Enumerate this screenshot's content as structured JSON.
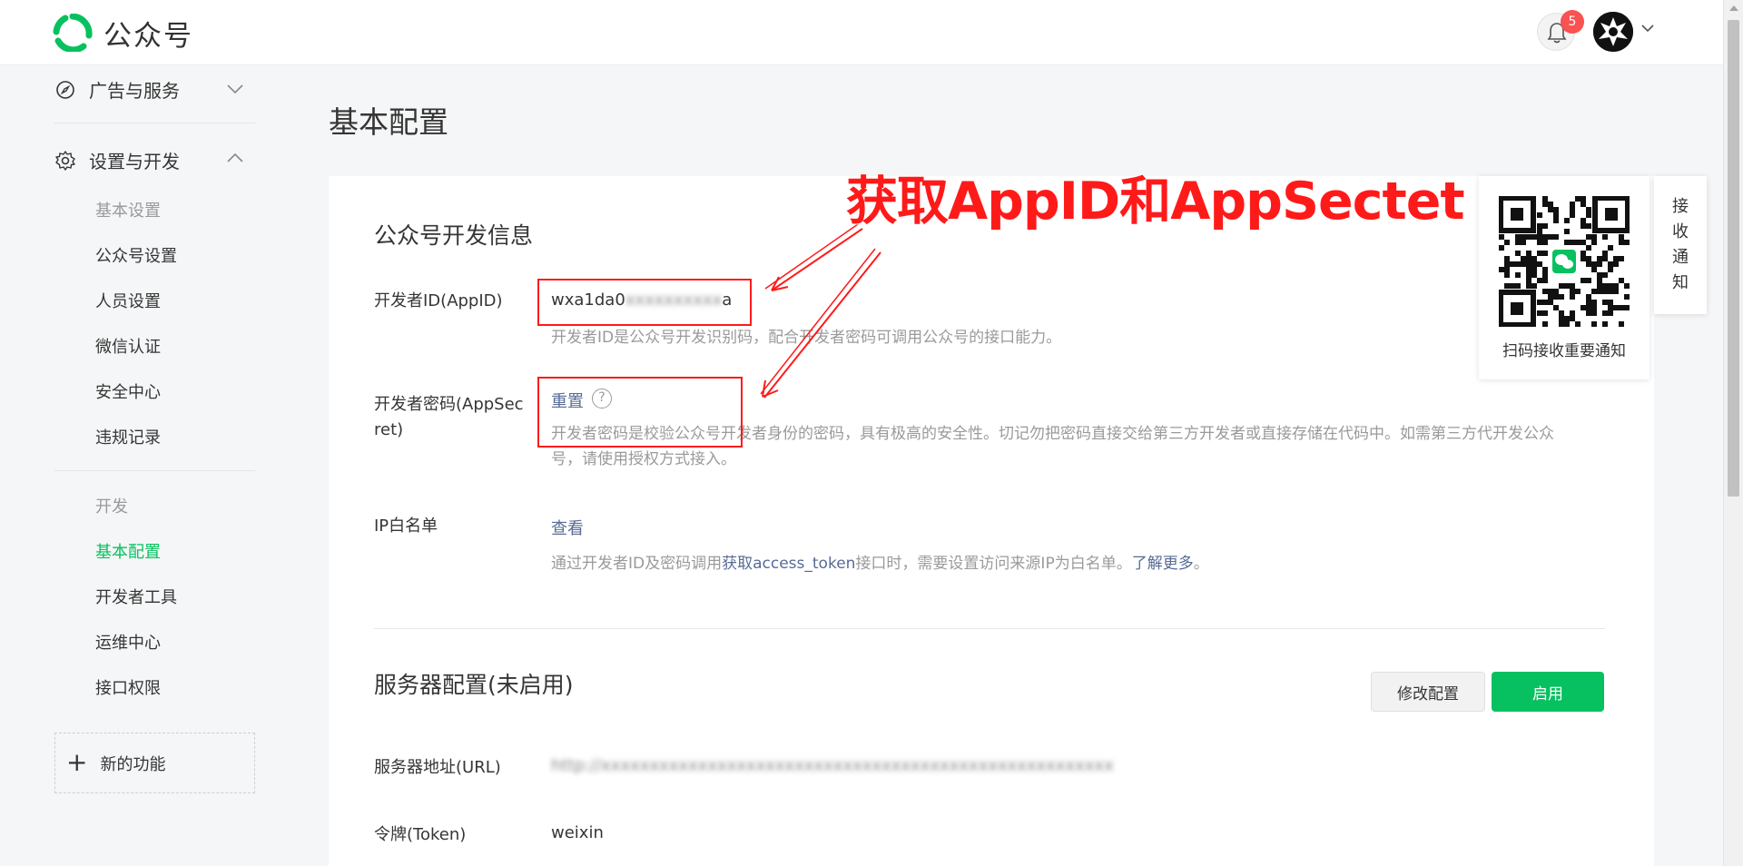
{
  "header": {
    "logo_text": "公众号",
    "notification_count": "5"
  },
  "sidebar": {
    "groups": [
      {
        "label": "广告与服务"
      },
      {
        "label": "设置与开发"
      }
    ],
    "settings_items": [
      "基本设置",
      "公众号设置",
      "人员设置",
      "微信认证",
      "安全中心",
      "违规记录"
    ],
    "dev_header": "开发",
    "dev_items": [
      "基本配置",
      "开发者工具",
      "运维中心",
      "接口权限"
    ],
    "new_feature": "新的功能"
  },
  "main": {
    "page_title": "基本配置",
    "dev_info": {
      "title": "公众号开发信息",
      "appid_label": "开发者ID(AppID)",
      "appid_prefix": "wxa1da0",
      "appid_suffix": "a",
      "appid_hint": "开发者ID是公众号开发识别码，配合开发者密码可调用公众号的接口能力。",
      "secret_label_1": "开发者密码(AppSec",
      "secret_label_2": "ret)",
      "secret_action": "重置",
      "secret_hint_1": "开发者密码是校验公众号开发者身份的密码，具有极高的安全性。切记勿把密码直接交给第三方开发者或直接存储在代码中。如需第三方代开发公众",
      "secret_hint_2": "号，请使用授权方式接入。",
      "ip_label": "IP白名单",
      "ip_action": "查看",
      "ip_hint_pre": "通过开发者ID及密码调用",
      "ip_hint_link": "获取access_token",
      "ip_hint_mid": "接口时，需要设置访问来源IP为白名单。",
      "ip_hint_more": "了解更多",
      "ip_hint_end": "。"
    },
    "server": {
      "title": "服务器配置(未启用)",
      "modify_button": "修改配置",
      "enable_button": "启用",
      "url_label": "服务器地址(URL)",
      "token_label": "令牌(Token)",
      "token_value": "weixin"
    }
  },
  "qr_panel": {
    "caption": "扫码接收重要通知"
  },
  "notify_tab": {
    "chars": [
      "接",
      "收",
      "通",
      "知"
    ]
  },
  "annotation": {
    "text": "获取AppID和AppSectet"
  },
  "colors": {
    "accent_green": "#07c160",
    "link_blue": "#576b95",
    "annotation_red": "#ff1a1a",
    "badge_red": "#fa5151"
  }
}
